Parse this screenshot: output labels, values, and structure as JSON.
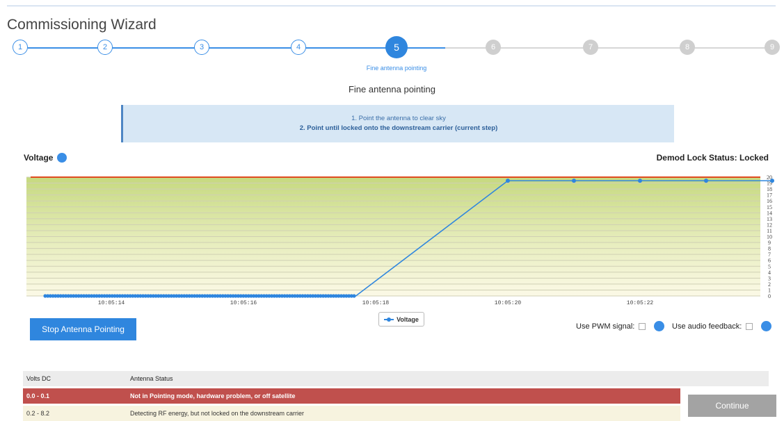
{
  "wizard": {
    "title": "Commissioning Wizard",
    "steps": [
      "1",
      "2",
      "3",
      "4",
      "5",
      "6",
      "7",
      "8",
      "9"
    ],
    "current_step": 5,
    "current_caption": "Fine antenna pointing"
  },
  "section": {
    "title": "Fine antenna pointing"
  },
  "instructions": {
    "step1": "1. Point the antenna to clear sky",
    "step2": "2. Point until locked onto the downstream carrier (current step)"
  },
  "voltage": {
    "label": "Voltage",
    "help_icon": "info-dot-icon"
  },
  "demod": {
    "text": "Demod Lock Status: Locked"
  },
  "chart_data": {
    "type": "line",
    "title": "",
    "xlabel": "",
    "ylabel": "",
    "ylim": [
      0,
      20
    ],
    "x_ticks": [
      "10:05:14",
      "10:05:16",
      "10:05:18",
      "10:05:20",
      "10:05:22"
    ],
    "y_ticks": [
      0,
      1,
      2,
      3,
      4,
      5,
      6,
      7,
      8,
      9,
      10,
      11,
      12,
      13,
      14,
      15,
      16,
      17,
      18,
      19,
      20
    ],
    "threshold_line": 20,
    "series": [
      {
        "name": "Voltage",
        "color": "#2f86de",
        "x": [
          "10:05:13",
          "10:05:17.7",
          "10:05:20",
          "10:05:21",
          "10:05:22",
          "10:05:23",
          "10:05:24"
        ],
        "y": [
          0,
          0,
          19.4,
          19.4,
          19.4,
          19.4,
          19.4
        ]
      }
    ]
  },
  "legend": {
    "label": "Voltage"
  },
  "controls": {
    "stop_button": "Stop Antenna Pointing",
    "pwm_label": "Use PWM signal:",
    "audio_label": "Use audio feedback:"
  },
  "table": {
    "headers": [
      "Volts DC",
      "Antenna Status"
    ],
    "rows": [
      {
        "range": "0.0 - 0.1",
        "status": "Not in Pointing mode, hardware problem, or off satellite"
      },
      {
        "range": "0.2 - 8.2",
        "status": "Detecting RF energy, but not locked on the downstream carrier"
      }
    ]
  },
  "continue_button": "Continue",
  "colors": {
    "accent": "#2f86de",
    "error": "#c0504d",
    "disabled": "#a3a3a3"
  }
}
